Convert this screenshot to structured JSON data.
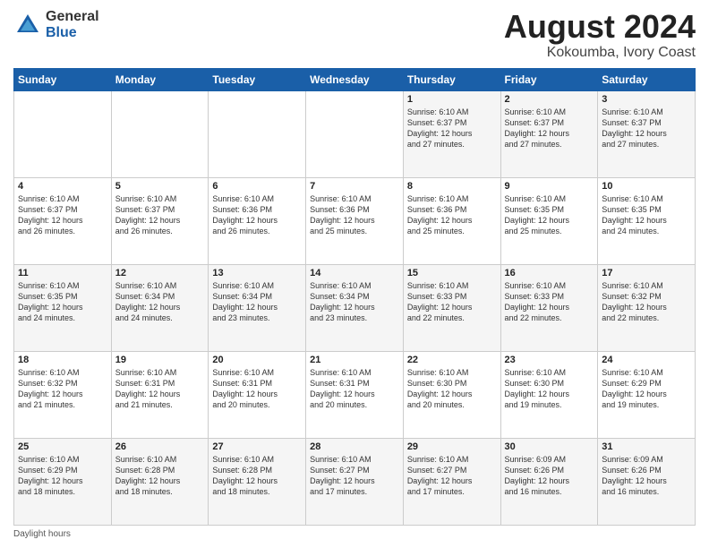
{
  "header": {
    "logo_general": "General",
    "logo_blue": "Blue",
    "title": "August 2024",
    "subtitle": "Kokoumba, Ivory Coast"
  },
  "days_of_week": [
    "Sunday",
    "Monday",
    "Tuesday",
    "Wednesday",
    "Thursday",
    "Friday",
    "Saturday"
  ],
  "weeks": [
    [
      {
        "day": "",
        "info": ""
      },
      {
        "day": "",
        "info": ""
      },
      {
        "day": "",
        "info": ""
      },
      {
        "day": "",
        "info": ""
      },
      {
        "day": "1",
        "info": "Sunrise: 6:10 AM\nSunset: 6:37 PM\nDaylight: 12 hours\nand 27 minutes."
      },
      {
        "day": "2",
        "info": "Sunrise: 6:10 AM\nSunset: 6:37 PM\nDaylight: 12 hours\nand 27 minutes."
      },
      {
        "day": "3",
        "info": "Sunrise: 6:10 AM\nSunset: 6:37 PM\nDaylight: 12 hours\nand 27 minutes."
      }
    ],
    [
      {
        "day": "4",
        "info": "Sunrise: 6:10 AM\nSunset: 6:37 PM\nDaylight: 12 hours\nand 26 minutes."
      },
      {
        "day": "5",
        "info": "Sunrise: 6:10 AM\nSunset: 6:37 PM\nDaylight: 12 hours\nand 26 minutes."
      },
      {
        "day": "6",
        "info": "Sunrise: 6:10 AM\nSunset: 6:36 PM\nDaylight: 12 hours\nand 26 minutes."
      },
      {
        "day": "7",
        "info": "Sunrise: 6:10 AM\nSunset: 6:36 PM\nDaylight: 12 hours\nand 25 minutes."
      },
      {
        "day": "8",
        "info": "Sunrise: 6:10 AM\nSunset: 6:36 PM\nDaylight: 12 hours\nand 25 minutes."
      },
      {
        "day": "9",
        "info": "Sunrise: 6:10 AM\nSunset: 6:35 PM\nDaylight: 12 hours\nand 25 minutes."
      },
      {
        "day": "10",
        "info": "Sunrise: 6:10 AM\nSunset: 6:35 PM\nDaylight: 12 hours\nand 24 minutes."
      }
    ],
    [
      {
        "day": "11",
        "info": "Sunrise: 6:10 AM\nSunset: 6:35 PM\nDaylight: 12 hours\nand 24 minutes."
      },
      {
        "day": "12",
        "info": "Sunrise: 6:10 AM\nSunset: 6:34 PM\nDaylight: 12 hours\nand 24 minutes."
      },
      {
        "day": "13",
        "info": "Sunrise: 6:10 AM\nSunset: 6:34 PM\nDaylight: 12 hours\nand 23 minutes."
      },
      {
        "day": "14",
        "info": "Sunrise: 6:10 AM\nSunset: 6:34 PM\nDaylight: 12 hours\nand 23 minutes."
      },
      {
        "day": "15",
        "info": "Sunrise: 6:10 AM\nSunset: 6:33 PM\nDaylight: 12 hours\nand 22 minutes."
      },
      {
        "day": "16",
        "info": "Sunrise: 6:10 AM\nSunset: 6:33 PM\nDaylight: 12 hours\nand 22 minutes."
      },
      {
        "day": "17",
        "info": "Sunrise: 6:10 AM\nSunset: 6:32 PM\nDaylight: 12 hours\nand 22 minutes."
      }
    ],
    [
      {
        "day": "18",
        "info": "Sunrise: 6:10 AM\nSunset: 6:32 PM\nDaylight: 12 hours\nand 21 minutes."
      },
      {
        "day": "19",
        "info": "Sunrise: 6:10 AM\nSunset: 6:31 PM\nDaylight: 12 hours\nand 21 minutes."
      },
      {
        "day": "20",
        "info": "Sunrise: 6:10 AM\nSunset: 6:31 PM\nDaylight: 12 hours\nand 20 minutes."
      },
      {
        "day": "21",
        "info": "Sunrise: 6:10 AM\nSunset: 6:31 PM\nDaylight: 12 hours\nand 20 minutes."
      },
      {
        "day": "22",
        "info": "Sunrise: 6:10 AM\nSunset: 6:30 PM\nDaylight: 12 hours\nand 20 minutes."
      },
      {
        "day": "23",
        "info": "Sunrise: 6:10 AM\nSunset: 6:30 PM\nDaylight: 12 hours\nand 19 minutes."
      },
      {
        "day": "24",
        "info": "Sunrise: 6:10 AM\nSunset: 6:29 PM\nDaylight: 12 hours\nand 19 minutes."
      }
    ],
    [
      {
        "day": "25",
        "info": "Sunrise: 6:10 AM\nSunset: 6:29 PM\nDaylight: 12 hours\nand 18 minutes."
      },
      {
        "day": "26",
        "info": "Sunrise: 6:10 AM\nSunset: 6:28 PM\nDaylight: 12 hours\nand 18 minutes."
      },
      {
        "day": "27",
        "info": "Sunrise: 6:10 AM\nSunset: 6:28 PM\nDaylight: 12 hours\nand 18 minutes."
      },
      {
        "day": "28",
        "info": "Sunrise: 6:10 AM\nSunset: 6:27 PM\nDaylight: 12 hours\nand 17 minutes."
      },
      {
        "day": "29",
        "info": "Sunrise: 6:10 AM\nSunset: 6:27 PM\nDaylight: 12 hours\nand 17 minutes."
      },
      {
        "day": "30",
        "info": "Sunrise: 6:09 AM\nSunset: 6:26 PM\nDaylight: 12 hours\nand 16 minutes."
      },
      {
        "day": "31",
        "info": "Sunrise: 6:09 AM\nSunset: 6:26 PM\nDaylight: 12 hours\nand 16 minutes."
      }
    ]
  ],
  "footer": {
    "daylight_label": "Daylight hours"
  }
}
